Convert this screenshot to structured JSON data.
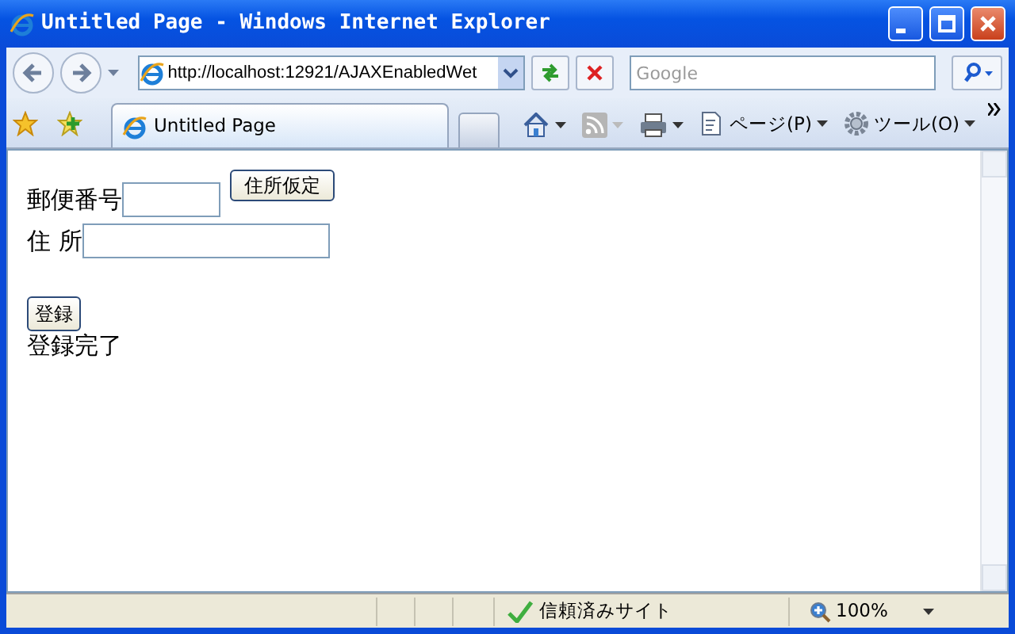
{
  "window": {
    "title": "Untitled Page - Windows Internet Explorer"
  },
  "address_bar": {
    "url": "http://localhost:12921/AJAXEnabledWet"
  },
  "search": {
    "placeholder": "Google"
  },
  "tabs": [
    {
      "label": "Untitled Page",
      "selected": true
    }
  ],
  "command_bar": {
    "page_menu": "ページ(P)",
    "tools_menu": "ツール(O)"
  },
  "form": {
    "rows": [
      {
        "kind": "lookup",
        "label": "郵便番号",
        "button": "住所仮定"
      },
      {
        "kind": "text",
        "label": "住 所"
      }
    ],
    "submit": "登録",
    "message": "登録完了"
  },
  "status_bar": {
    "zone": "信頼済みサイト",
    "zoom": "100%"
  }
}
